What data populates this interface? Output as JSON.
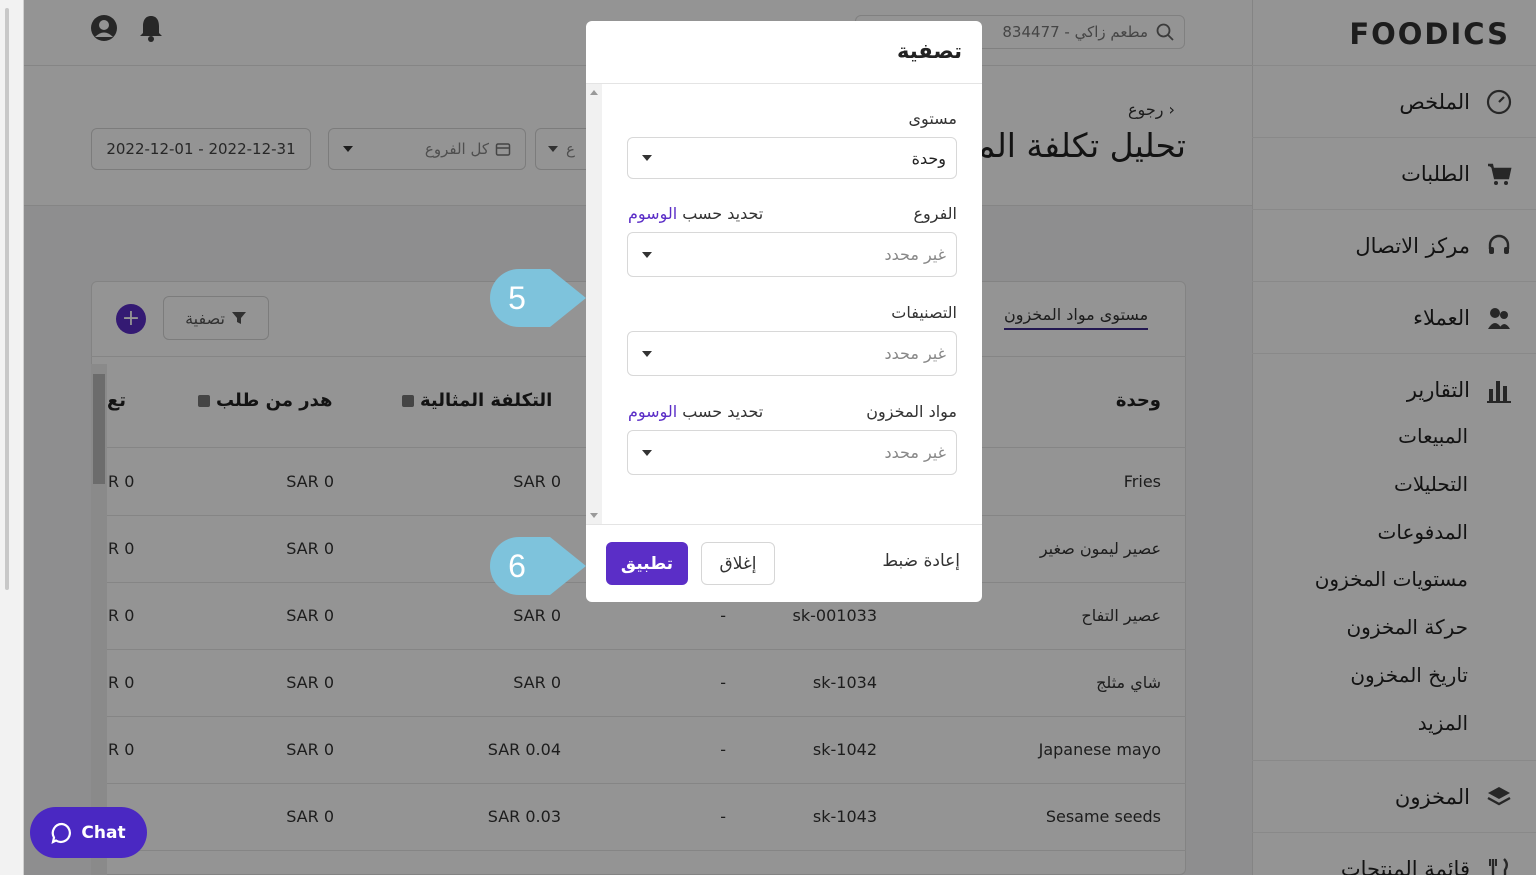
{
  "sidebar": {
    "logo": "FOODICS",
    "items": [
      {
        "label": "الملخص",
        "icon": "dashboard-gauge-icon"
      },
      {
        "label": "الطلبات",
        "icon": "cart-icon"
      },
      {
        "label": "مركز الاتصال",
        "icon": "headset-icon"
      },
      {
        "label": "العملاء",
        "icon": "customers-icon"
      },
      {
        "label": "التقارير",
        "icon": "bar-chart-icon"
      },
      {
        "label": "المخزون",
        "icon": "layers-icon"
      },
      {
        "label": "قائمة المنتجات",
        "icon": "cutlery-icon"
      }
    ],
    "report_subitems": [
      "المبيعات",
      "التحليلات",
      "المدفوعات",
      "مستويات المخزون",
      "حركة المخزون",
      "تاريخ المخزون",
      "المزيد"
    ]
  },
  "topbar": {
    "search_text": "مطعم زاكي - 834477"
  },
  "page": {
    "back_label": "رجوع",
    "title": "تحليل تكلفة المخزون",
    "date_range": "2022-12-01 - 2022-12-31",
    "branches": "كل الفروع",
    "third_filter": "ع"
  },
  "card": {
    "tab_label": "مستوى مواد المخزون",
    "filter_label": "تصفية",
    "add_label": "+",
    "columns": [
      "وحدة",
      "التكلفة المثالية",
      "هدر من طلب",
      "تع"
    ],
    "rows": [
      {
        "name": "Fries",
        "sku": "",
        "dash": "",
        "ideal": "SAR 0",
        "waste": "SAR 0",
        "cut": "R 0"
      },
      {
        "name": "عصير ليمون صغير",
        "sku": "",
        "dash": "",
        "ideal": "",
        "waste": "SAR 0",
        "cut": "R 0"
      },
      {
        "name": "عصير التفاح",
        "sku": "sk-001033",
        "dash": "-",
        "ideal": "SAR 0",
        "waste": "SAR 0",
        "cut": "R 0"
      },
      {
        "name": "شاي مثلج",
        "sku": "sk-1034",
        "dash": "-",
        "ideal": "SAR 0",
        "waste": "SAR 0",
        "cut": "R 0"
      },
      {
        "name": "Japanese mayo",
        "sku": "sk-1042",
        "dash": "-",
        "ideal": "SAR 0.04",
        "waste": "SAR 0",
        "cut": "R 0"
      },
      {
        "name": "Sesame seeds",
        "sku": "sk-1043",
        "dash": "-",
        "ideal": "SAR 0.03",
        "waste": "SAR 0",
        "cut": ""
      }
    ]
  },
  "modal": {
    "title": "تصفية",
    "fields": [
      {
        "label": "مستوى",
        "value": "وحدة",
        "placeholder": "",
        "extra": "",
        "extra_link": ""
      },
      {
        "label": "الفروع",
        "value": "",
        "placeholder": "غير محدد",
        "extra": "تحديد حسب",
        "extra_link": "الوسوم"
      },
      {
        "label": "التصنيفات",
        "value": "",
        "placeholder": "غير محدد",
        "extra": "",
        "extra_link": ""
      },
      {
        "label": "مواد المخزون",
        "value": "",
        "placeholder": "غير محدد",
        "extra": "تحديد حسب",
        "extra_link": "الوسوم"
      }
    ],
    "reset_label": "إعادة ضبط",
    "close_label": "إغلاق",
    "apply_label": "تطبيق"
  },
  "callouts": [
    "5",
    "6"
  ],
  "chat": {
    "label": "Chat"
  },
  "colors": {
    "accent": "#5b2ec7",
    "callout": "#7ec3dc",
    "overlay": "rgba(0,0,0,0.42)"
  }
}
